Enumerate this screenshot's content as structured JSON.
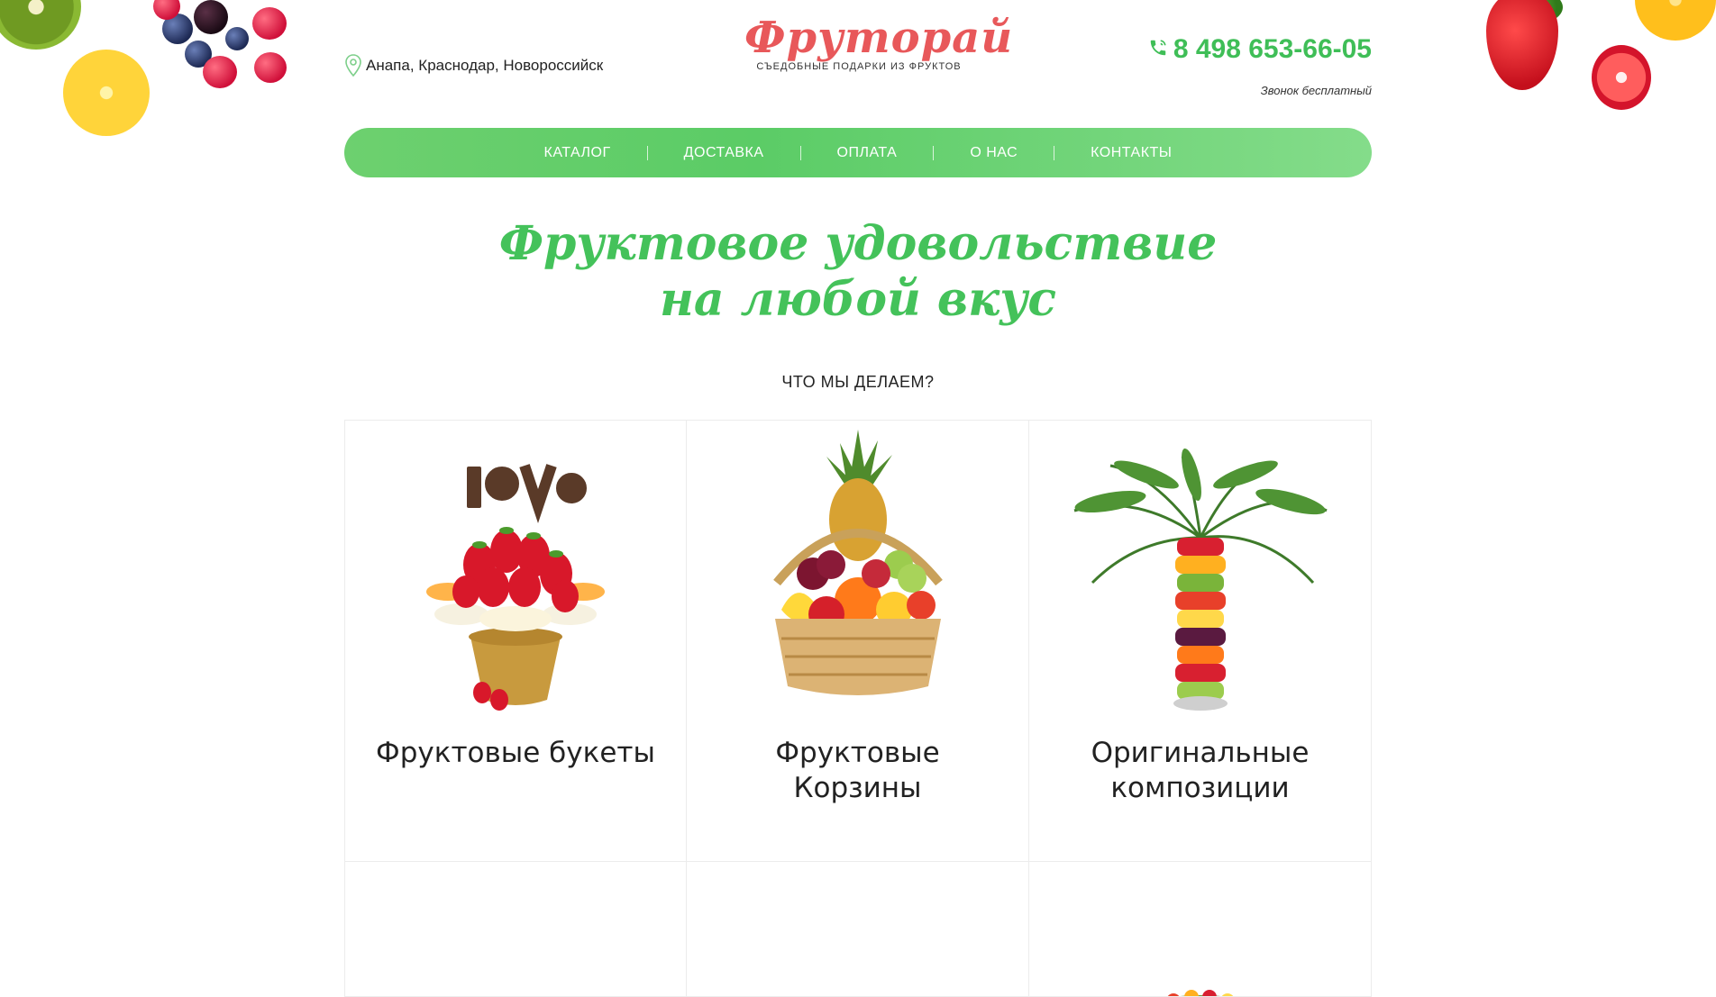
{
  "header": {
    "location": "Анапа, Краснодар, Новороссийск",
    "logo_title": "Фруторай",
    "logo_subtitle": "СЪЕДОБНЫЕ ПОДАРКИ ИЗ ФРУКТОВ",
    "phone": "8 498 653-66-05",
    "phone_note": "Звонок бесплатный"
  },
  "nav": {
    "items": [
      {
        "label": "КАТАЛОГ"
      },
      {
        "label": "ДОСТАВКА"
      },
      {
        "label": "ОПЛАТА"
      },
      {
        "label": "О НАС"
      },
      {
        "label": "КОНТАКТЫ"
      }
    ]
  },
  "hero": {
    "headline_line1": "Фруктовое удовольствие",
    "headline_line2": "на любой вкус",
    "section_label": "ЧТО МЫ ДЕЛАЕМ?"
  },
  "cards": [
    {
      "title": "Фруктовые букеты",
      "icon": "fruit-bouquet-image"
    },
    {
      "title": "Фруктовые Корзины",
      "icon": "fruit-basket-image"
    },
    {
      "title": "Оригинальные композиции",
      "icon": "fruit-palm-image"
    }
  ],
  "colors": {
    "brand_green": "#44c25a",
    "logo_red": "#e8585a",
    "nav_green": "#5bcc66"
  }
}
